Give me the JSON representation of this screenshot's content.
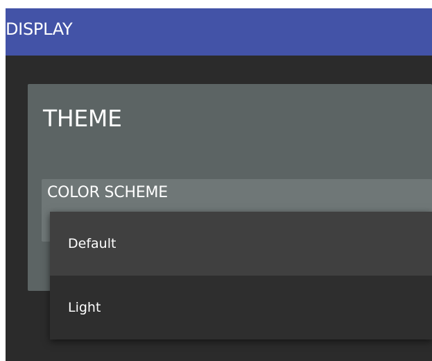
{
  "header": {
    "title": "DISPLAY"
  },
  "theme": {
    "title": "THEME",
    "color_scheme": {
      "label": "COLOR SCHEME",
      "options": [
        {
          "label": "Default",
          "selected": true
        },
        {
          "label": "Light",
          "selected": false
        }
      ]
    }
  },
  "colors": {
    "header_bg": "#4353a7",
    "page_bg": "#2b2b2b",
    "card_bg": "#5c6464",
    "field_bg": "#6f7777",
    "menu_bg": "#2e2e2e",
    "menu_selected_bg": "#404040"
  }
}
